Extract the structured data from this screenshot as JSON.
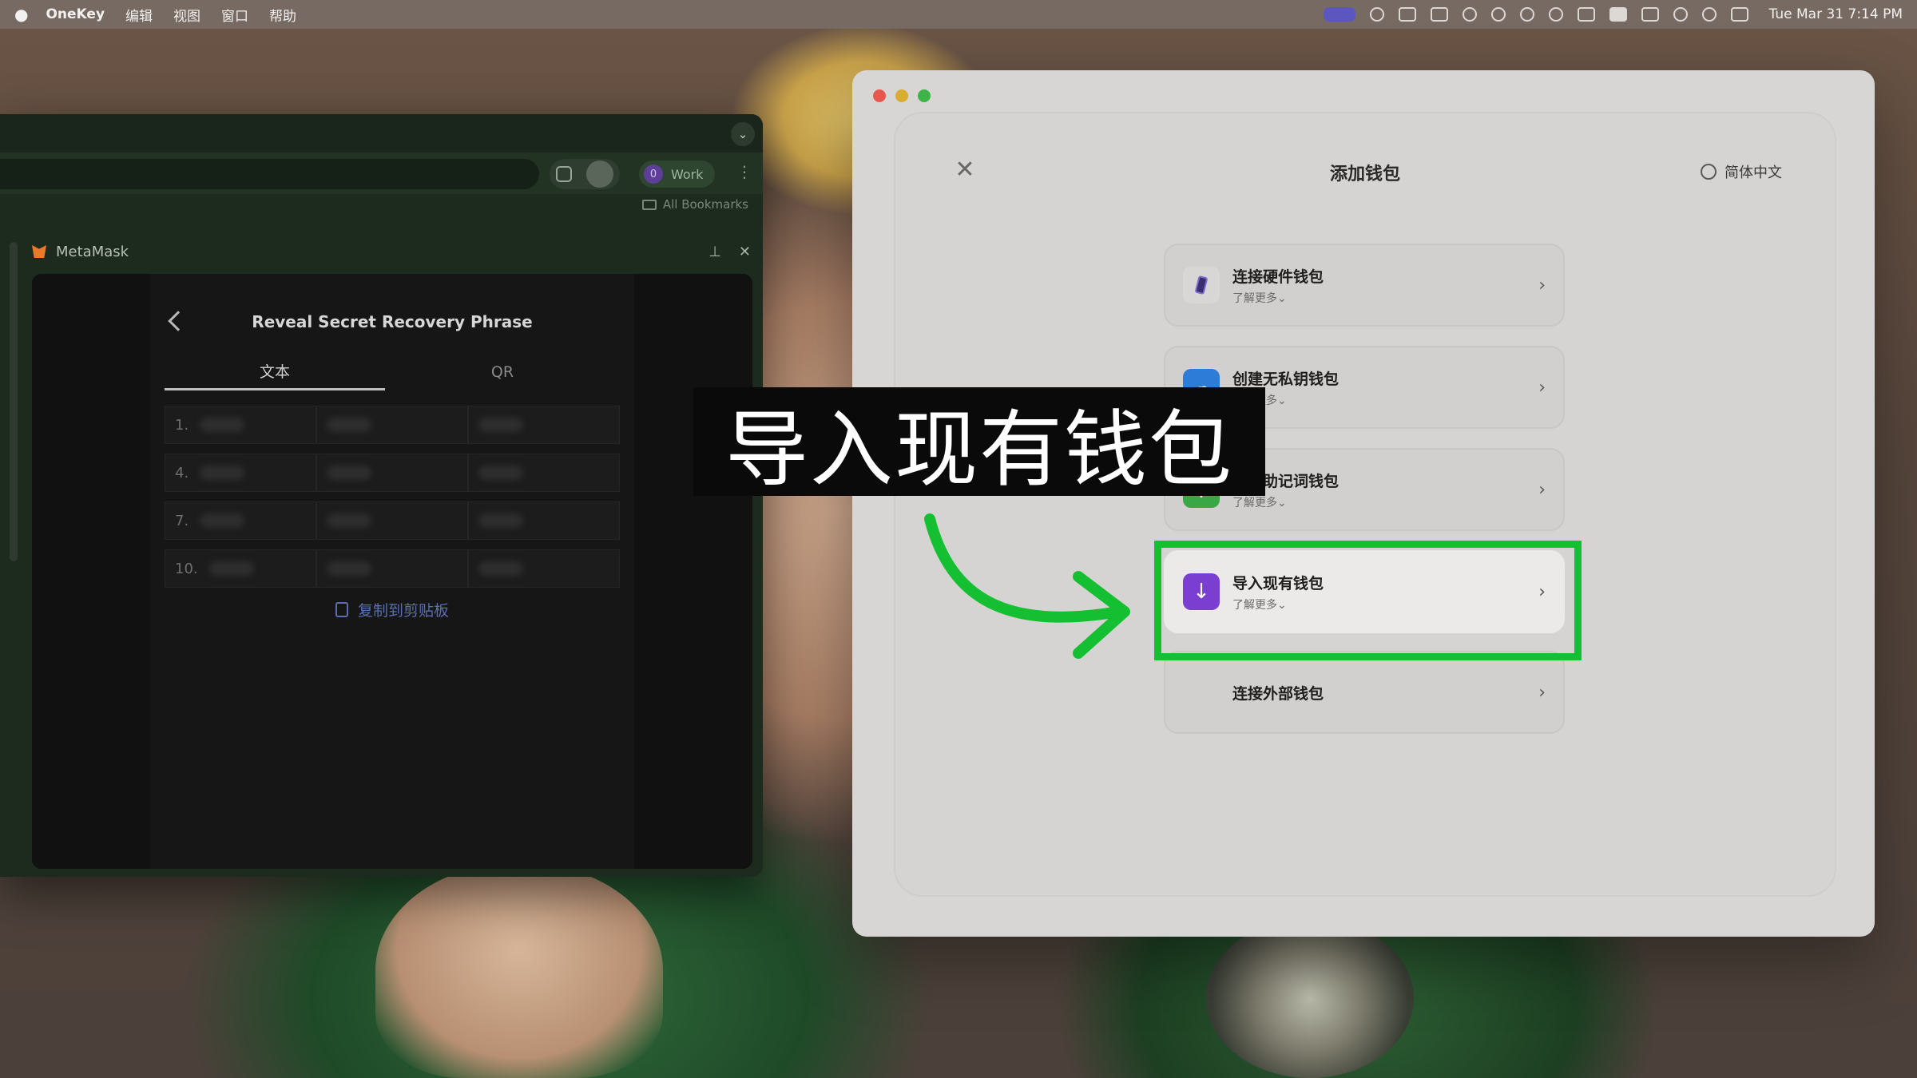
{
  "menubar": {
    "app_name": "OneKey",
    "menus": [
      "编辑",
      "视图",
      "窗口",
      "帮助"
    ],
    "clock": "Tue Mar 31  7:14 PM",
    "status_icons": [
      "screen-record-icon",
      "record-icon",
      "cursor-icon",
      "tools-icon",
      "bluetooth-icon",
      "headphones-icon",
      "play-icon",
      "airdrop-icon",
      "bed-icon",
      "keyboard-a-icon",
      "battery-icon",
      "wifi-icon",
      "search-icon",
      "control-center-icon"
    ]
  },
  "browser": {
    "profile_badge": "0",
    "profile_name": "Work",
    "bookmarks_label": "All Bookmarks",
    "side_panel_title": "MetaMask"
  },
  "metamask": {
    "title": "Reveal Secret Recovery Phrase",
    "tabs": [
      {
        "label": "文本",
        "active": true
      },
      {
        "label": "QR",
        "active": false
      }
    ],
    "row_numbers": [
      "1.",
      "4.",
      "7.",
      "10."
    ],
    "copy_label": "复制到剪贴板"
  },
  "onekey": {
    "title": "添加钱包",
    "language": "简体中文",
    "options": [
      {
        "label": "连接硬件钱包",
        "sub": "了解更多⌄",
        "icon": "hardware-wallet-icon"
      },
      {
        "label": "创建无私钥钱包",
        "sub": "了解更多⌄",
        "icon": "cloud-icon"
      },
      {
        "label": "创建助记词钱包",
        "sub": "了解更多⌄",
        "icon": "plus-icon"
      },
      {
        "label": "导入现有钱包",
        "sub": "了解更多⌄",
        "icon": "import-arrow-icon",
        "highlighted": true
      },
      {
        "label": "连接外部钱包",
        "sub": "",
        "icon": "external-wallets-icon"
      }
    ]
  },
  "overlay": {
    "caption": "导入现有钱包",
    "highlight_color": "#14c032"
  }
}
